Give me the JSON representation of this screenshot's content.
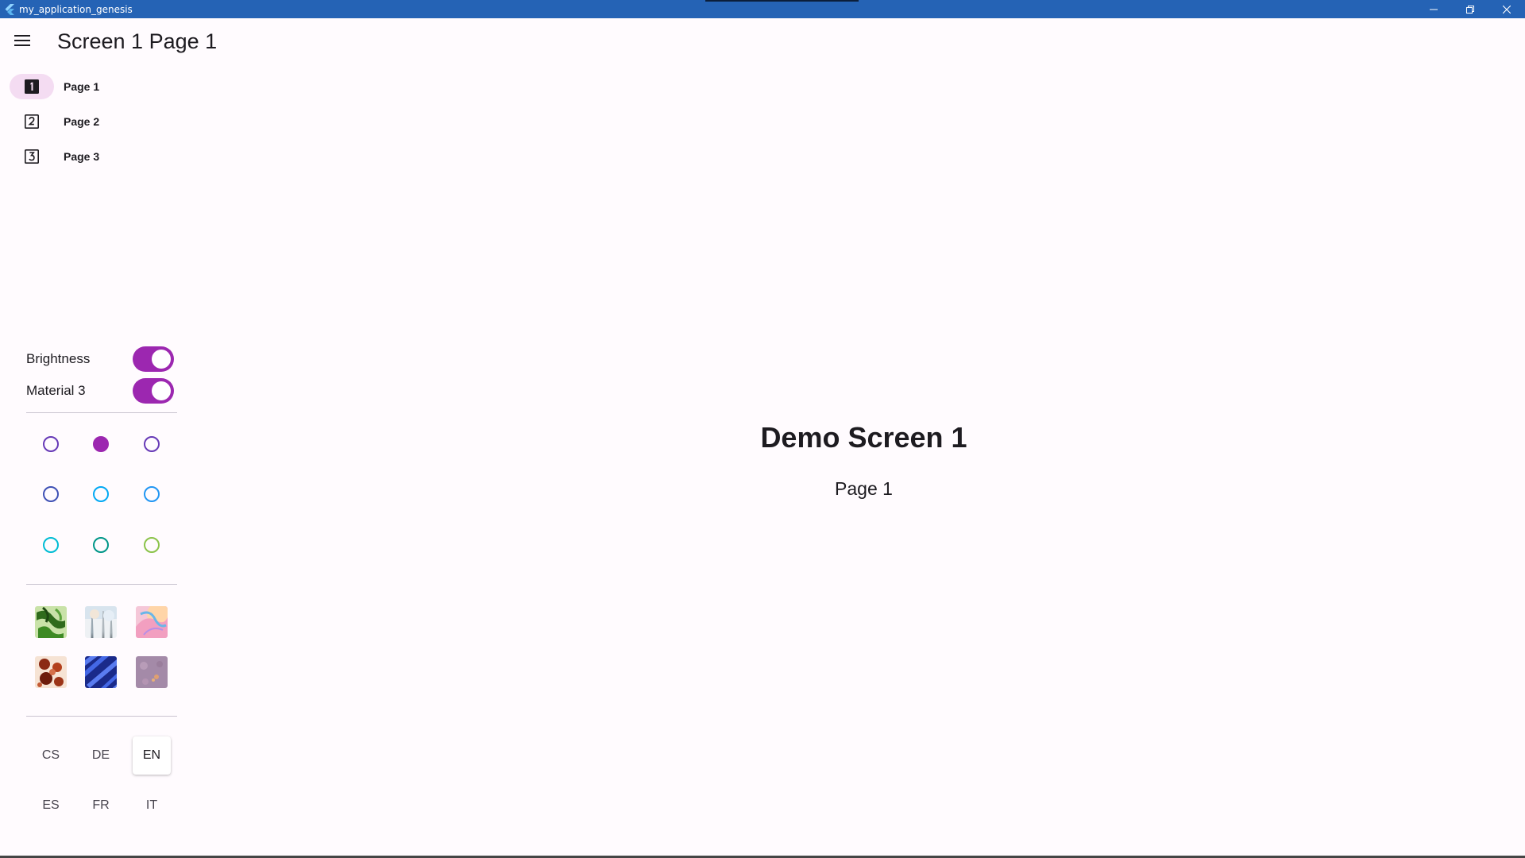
{
  "window": {
    "title": "my_application_genesis",
    "app_icon": "flutter-icon",
    "controls": [
      "minimize-icon",
      "restore-icon",
      "close-icon"
    ],
    "titlebar_color": "#2563b5"
  },
  "appbar": {
    "menu_icon": "menu-icon",
    "title": "Screen 1 Page 1"
  },
  "nav": {
    "items": [
      {
        "label": "Page 1",
        "icon": "filter-1-icon",
        "active": true
      },
      {
        "label": "Page 2",
        "icon": "filter-2-icon",
        "active": false
      },
      {
        "label": "Page 3",
        "icon": "filter-3-icon",
        "active": false
      }
    ]
  },
  "settings": {
    "brightness": {
      "label": "Brightness",
      "on": true
    },
    "material3": {
      "label": "Material 3",
      "on": true
    },
    "accent_color": "#9c27b0",
    "color_options": [
      {
        "color": "#673ab7",
        "selected": false
      },
      {
        "color": "#9c27b0",
        "selected": true
      },
      {
        "color": "#673ab7",
        "selected": false
      },
      {
        "color": "#3f51b5",
        "selected": false
      },
      {
        "color": "#03a9f4",
        "selected": false
      },
      {
        "color": "#2196f3",
        "selected": false
      },
      {
        "color": "#00bcd4",
        "selected": false
      },
      {
        "color": "#009688",
        "selected": false
      },
      {
        "color": "#8bc34a",
        "selected": false
      }
    ],
    "image_options": [
      {
        "name": "green-leaves-image"
      },
      {
        "name": "winter-trees-image"
      },
      {
        "name": "pastel-swirl-image"
      },
      {
        "name": "red-floral-image"
      },
      {
        "name": "blue-stripes-image"
      },
      {
        "name": "mauve-texture-image"
      }
    ],
    "languages": [
      {
        "code": "CS",
        "selected": false
      },
      {
        "code": "DE",
        "selected": false
      },
      {
        "code": "EN",
        "selected": true
      },
      {
        "code": "ES",
        "selected": false
      },
      {
        "code": "FR",
        "selected": false
      },
      {
        "code": "IT",
        "selected": false
      }
    ]
  },
  "main": {
    "heading": "Demo Screen 1",
    "subheading": "Page 1"
  }
}
